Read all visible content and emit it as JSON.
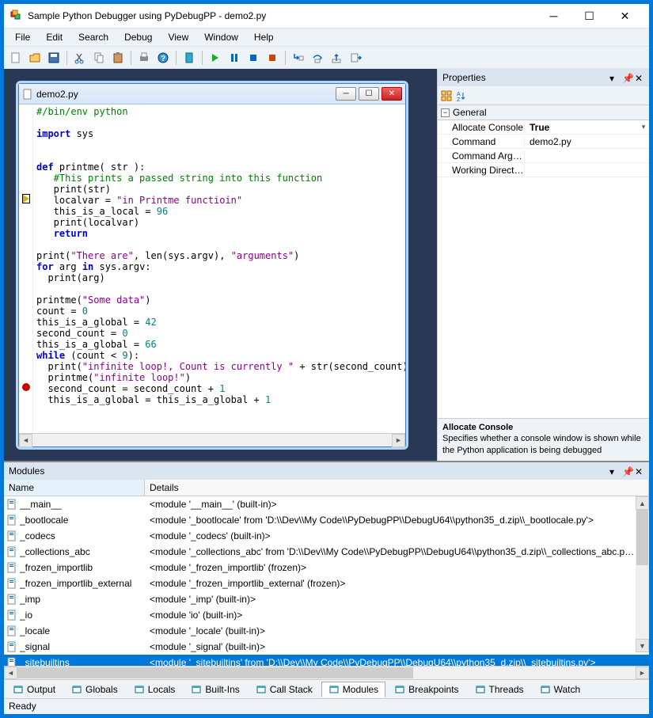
{
  "window": {
    "title": "Sample Python Debugger using PyDebugPP - demo2.py"
  },
  "menu": [
    "File",
    "Edit",
    "Search",
    "Debug",
    "View",
    "Window",
    "Help"
  ],
  "editor": {
    "filename": "demo2.py",
    "lines": [
      {
        "t": "cmt",
        "text": "#/bin/env python"
      },
      {
        "t": "",
        "text": ""
      },
      {
        "t": "kw-plain",
        "html": "<span class='kw'>import</span> sys"
      },
      {
        "t": "",
        "text": ""
      },
      {
        "t": "",
        "text": ""
      },
      {
        "t": "def",
        "html": "<span class='kw'>def</span> printme( str ):"
      },
      {
        "t": "cmt",
        "text": "   #This prints a passed string into this function"
      },
      {
        "t": "",
        "html": "   print(str)"
      },
      {
        "bp": "arrow",
        "html": "   localvar = <span class='str'>\"in Printme functioin\"</span>"
      },
      {
        "t": "",
        "html": "   this_is_a_local = <span class='num'>96</span>"
      },
      {
        "t": "",
        "html": "   print(localvar)"
      },
      {
        "t": "",
        "html": "   <span class='kw'>return</span>"
      },
      {
        "t": "",
        "text": ""
      },
      {
        "t": "",
        "html": "print(<span class='str'>\"There are\"</span>, len(sys.argv), <span class='str'>\"arguments\"</span>)"
      },
      {
        "t": "",
        "html": "<span class='kw'>for</span> arg <span class='kw'>in</span> sys.argv:"
      },
      {
        "t": "",
        "html": "  print(arg)"
      },
      {
        "t": "",
        "text": ""
      },
      {
        "t": "",
        "html": "printme(<span class='str'>\"Some data\"</span>)"
      },
      {
        "t": "",
        "html": "count = <span class='num'>0</span>"
      },
      {
        "t": "",
        "html": "this_is_a_global = <span class='num'>42</span>"
      },
      {
        "t": "",
        "html": "second_count = <span class='num'>0</span>"
      },
      {
        "t": "",
        "html": "this_is_a_global = <span class='num'>66</span>"
      },
      {
        "t": "",
        "html": "<span class='kw'>while</span> (count &lt; <span class='num'>9</span>):"
      },
      {
        "t": "",
        "html": "  print(<span class='str'>\"infinite loop!, Count is currently \"</span> + str(second_count))"
      },
      {
        "t": "",
        "html": "  printme(<span class='str'>\"infinite loop!\"</span>)"
      },
      {
        "bp": "dot",
        "html": "  second_count = second_count + <span class='num'>1</span>"
      },
      {
        "t": "",
        "html": "  this_is_a_global = this_is_a_global + <span class='num'>1</span>"
      }
    ]
  },
  "properties": {
    "title": "Properties",
    "category": "General",
    "rows": [
      {
        "name": "Allocate Console",
        "value": "True",
        "sel": true,
        "dd": true
      },
      {
        "name": "Command",
        "value": "demo2.py"
      },
      {
        "name": "Command Argu...",
        "value": ""
      },
      {
        "name": "Working Directory",
        "value": ""
      }
    ],
    "help": {
      "name": "Allocate Console",
      "desc": "Specifies whether a console window is shown while the Python application is being debugged"
    }
  },
  "modules": {
    "title": "Modules",
    "columns": {
      "name": "Name",
      "details": "Details"
    },
    "rows": [
      {
        "name": "__main__",
        "details": "<module '__main__' (built-in)>"
      },
      {
        "name": "_bootlocale",
        "details": "<module '_bootlocale' from 'D:\\\\Dev\\\\My Code\\\\PyDebugPP\\\\DebugU64\\\\python35_d.zip\\\\_bootlocale.py'>"
      },
      {
        "name": "_codecs",
        "details": "<module '_codecs' (built-in)>"
      },
      {
        "name": "_collections_abc",
        "details": "<module '_collections_abc' from 'D:\\\\Dev\\\\My Code\\\\PyDebugPP\\\\DebugU64\\\\python35_d.zip\\\\_collections_abc.py'>"
      },
      {
        "name": "_frozen_importlib",
        "details": "<module '_frozen_importlib' (frozen)>"
      },
      {
        "name": "_frozen_importlib_external",
        "details": "<module '_frozen_importlib_external' (frozen)>"
      },
      {
        "name": "_imp",
        "details": "<module '_imp' (built-in)>"
      },
      {
        "name": "_io",
        "details": "<module 'io' (built-in)>"
      },
      {
        "name": "_locale",
        "details": "<module '_locale' (built-in)>"
      },
      {
        "name": "_signal",
        "details": "<module '_signal' (built-in)>"
      },
      {
        "name": "_sitebuiltins",
        "details": "<module '_sitebuiltins' from 'D:\\\\Dev\\\\My Code\\\\PyDebugPP\\\\DebugU64\\\\python35_d.zip\\\\_sitebuiltins.py'>",
        "selected": true
      }
    ]
  },
  "tabs": [
    "Output",
    "Globals",
    "Locals",
    "Built-Ins",
    "Call Stack",
    "Modules",
    "Breakpoints",
    "Threads",
    "Watch"
  ],
  "tabs_active": 5,
  "status": "Ready"
}
